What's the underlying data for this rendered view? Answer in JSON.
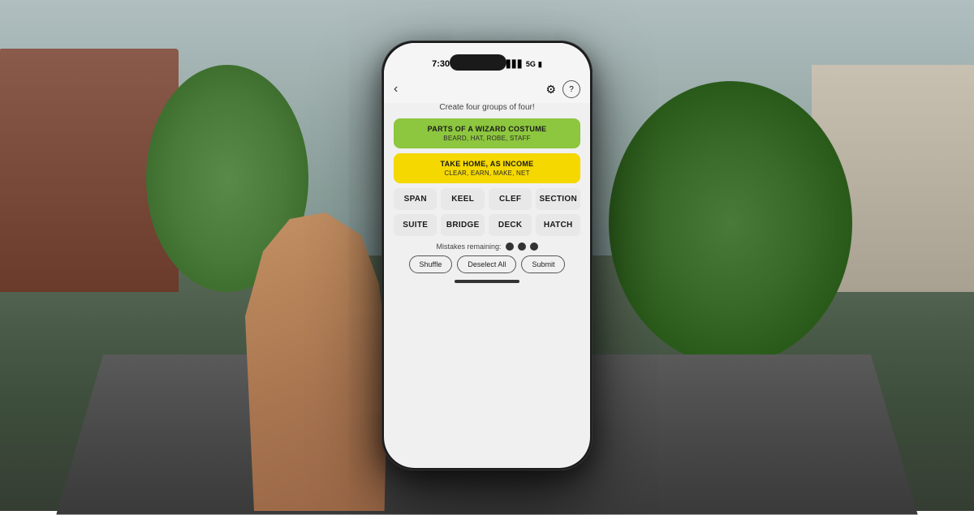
{
  "background": {
    "description": "Street scene in urban neighborhood"
  },
  "phone": {
    "status_bar": {
      "time": "7:30",
      "signal_icon": "●●●",
      "network": "5G",
      "battery": "🔋"
    },
    "app": {
      "instructions": "Create four groups of four!",
      "back_label": "‹",
      "completed_categories": [
        {
          "title": "PARTS OF A WIZARD COSTUME",
          "words": "BEARD, HAT, ROBE, STAFF",
          "color": "green",
          "color_hex": "#8dc63f"
        },
        {
          "title": "TAKE HOME, AS INCOME",
          "words": "CLEAR, EARN, MAKE, NET",
          "color": "yellow",
          "color_hex": "#f5d800"
        }
      ],
      "word_tiles": [
        "SPAN",
        "KEEL",
        "CLEF",
        "SECTION",
        "SUITE",
        "BRIDGE",
        "DECK",
        "HATCH"
      ],
      "mistakes": {
        "label": "Mistakes remaining:",
        "dots": 3,
        "filled": 3
      },
      "buttons": [
        "Shuffle",
        "Deselect All",
        "Submit"
      ]
    }
  }
}
